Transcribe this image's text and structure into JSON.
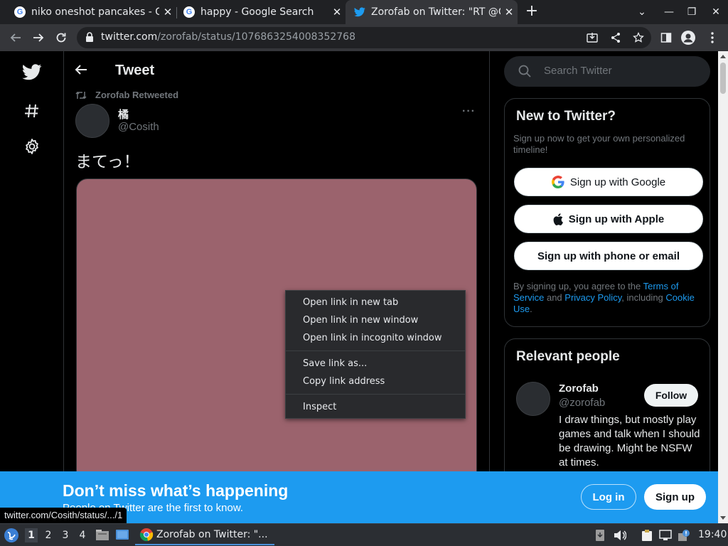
{
  "browser": {
    "tabs": [
      {
        "title": "niko oneshot pancakes - G",
        "favicon": "google-icon"
      },
      {
        "title": "happy - Google Search",
        "favicon": "google-icon"
      },
      {
        "title": "Zorofab on Twitter: \"RT @C",
        "favicon": "twitter-icon",
        "active": true
      }
    ],
    "url_host": "twitter.com",
    "url_path": "/zorofab/status/1076863254008352768"
  },
  "twitter": {
    "header_title": "Tweet",
    "retweeted_by": "Zorofab Retweeted",
    "author_name": "橘",
    "author_handle": "@Cosith",
    "tweet_text": "まてっ！",
    "more_label": "···",
    "search_placeholder": "Search Twitter",
    "new_to_twitter": {
      "title": "New to Twitter?",
      "subtitle": "Sign up now to get your own personalized timeline!",
      "google_label": "Sign up with Google",
      "apple_label": "Sign up with Apple",
      "phone_label": "Sign up with phone or email",
      "legal_prefix": "By signing up, you agree to the ",
      "terms": "Terms of Service",
      "and": " and ",
      "privacy": "Privacy Policy",
      "including": ", including ",
      "cookie": "Cookie Use",
      "period": "."
    },
    "relevant_people": {
      "title": "Relevant people",
      "name": "Zorofab",
      "handle": "@zorofab",
      "follow_label": "Follow",
      "bio": "I draw things, but mostly play games and talk when I should be drawing. Might be NSFW at times."
    },
    "banner": {
      "title": "Don’t miss what’s happening",
      "subtitle": "People on Twitter are the first to know.",
      "login_label": "Log in",
      "signup_label": "Sign up"
    },
    "media_color": "#9b636d"
  },
  "status_url": "twitter.com/Cosith/status/.../1",
  "context_menu": {
    "items": [
      "Open link in new tab",
      "Open link in new window",
      "Open link in incognito window",
      "Save link as...",
      "Copy link address",
      "Inspect"
    ]
  },
  "taskbar": {
    "workspaces": [
      "1",
      "2",
      "3",
      "4"
    ],
    "task_title": "Zorofab on Twitter: \"...",
    "clock": "19:40"
  }
}
